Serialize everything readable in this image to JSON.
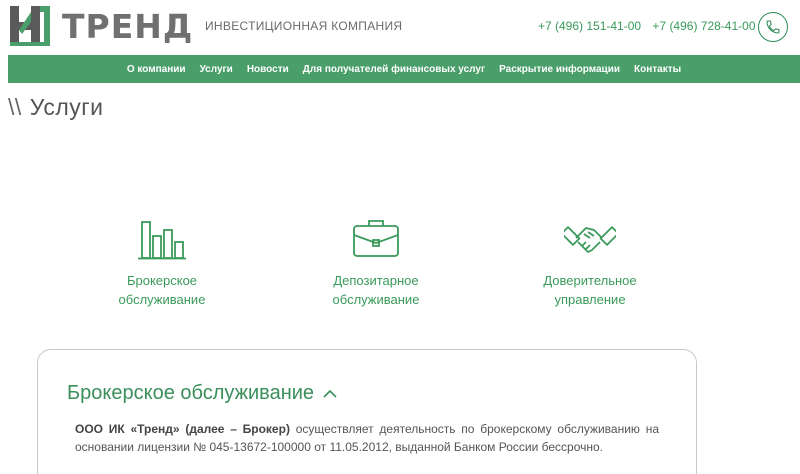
{
  "header": {
    "logo_text": "ТРЕНД",
    "tagline": "ИНВЕСТИЦИОННАЯ КОМПАНИЯ",
    "phones": [
      "+7 (496) 151-41-00",
      "+7 (496) 728-41-00"
    ]
  },
  "nav": {
    "items": [
      "О компании",
      "Услуги",
      "Новости",
      "Для получателей финансовых услуг",
      "Раскрытие информации",
      "Контакты"
    ]
  },
  "page": {
    "slashes": "\\\\",
    "title": "Услуги"
  },
  "services": [
    {
      "label_line1": "Брокерское",
      "label_line2": "обслуживание",
      "icon": "bar-chart-icon"
    },
    {
      "label_line1": "Депозитарное",
      "label_line2": "обслуживание",
      "icon": "briefcase-icon"
    },
    {
      "label_line1": "Доверительное",
      "label_line2": "управление",
      "icon": "handshake-icon"
    }
  ],
  "card": {
    "title": "Брокерское обслуживание",
    "company": "ООО ИК «Тренд» (далее – Брокер)",
    "text": " осуществляет деятельность по брокерскому обслуживанию на основании лицензии № 045-13672-100000 от 11.05.2012, выданной Банком России бессрочно."
  },
  "colors": {
    "brand_green": "#4a9e6a",
    "text_green": "#3a9a5a",
    "logo_gray": "#707070"
  }
}
